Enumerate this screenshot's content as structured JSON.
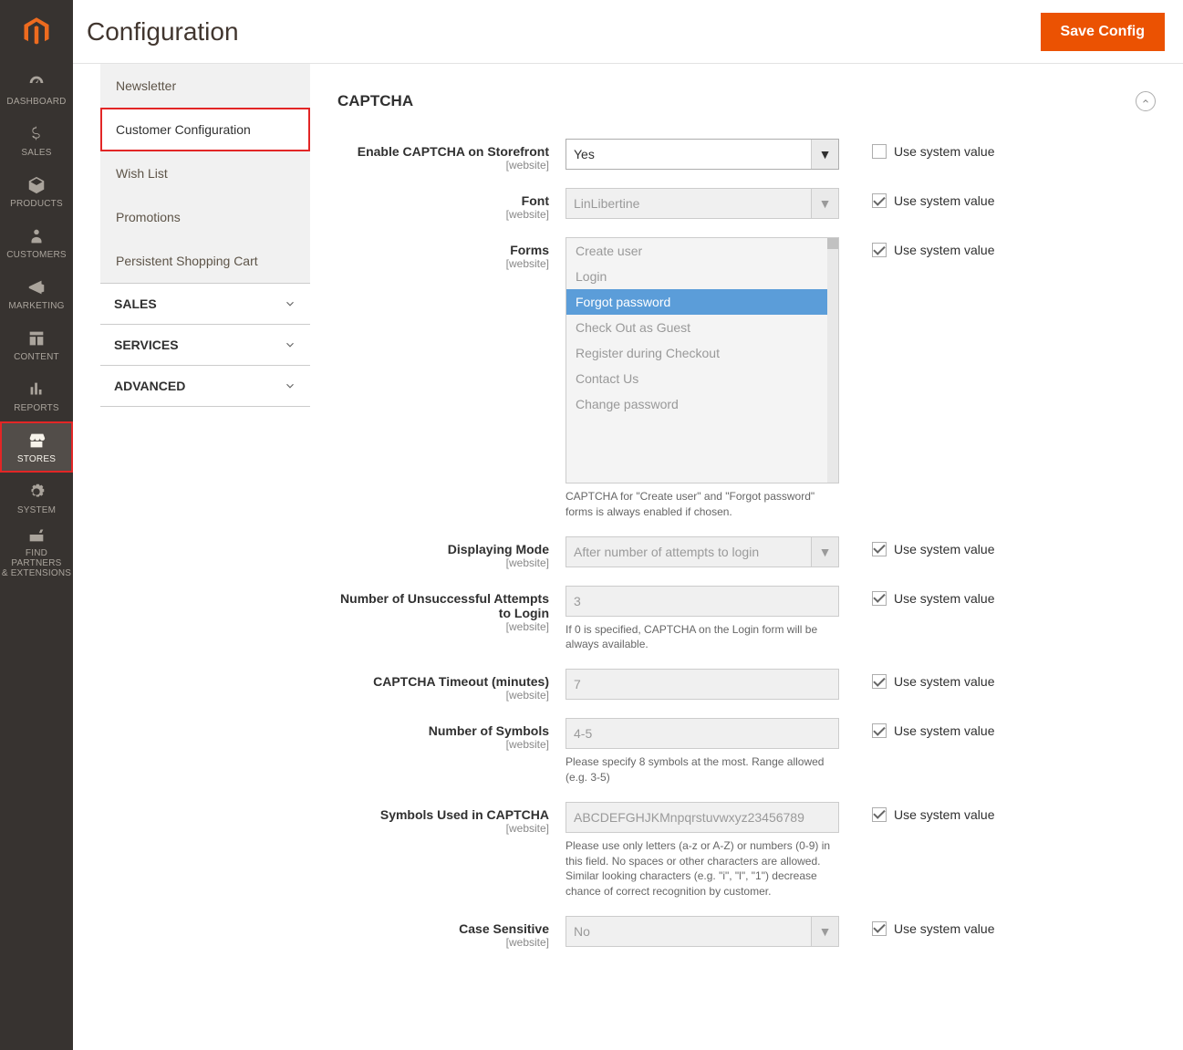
{
  "nav": {
    "items": [
      {
        "label": "DASHBOARD"
      },
      {
        "label": "SALES"
      },
      {
        "label": "PRODUCTS"
      },
      {
        "label": "CUSTOMERS"
      },
      {
        "label": "MARKETING"
      },
      {
        "label": "CONTENT"
      },
      {
        "label": "REPORTS"
      },
      {
        "label": "STORES"
      },
      {
        "label": "SYSTEM"
      },
      {
        "label": "FIND PARTNERS\n& EXTENSIONS"
      }
    ]
  },
  "header": {
    "title": "Configuration",
    "save_label": "Save Config"
  },
  "sidebar": {
    "items": [
      {
        "label": "Newsletter"
      },
      {
        "label": "Customer Configuration",
        "active": true
      },
      {
        "label": "Wish List"
      },
      {
        "label": "Promotions"
      },
      {
        "label": "Persistent Shopping Cart"
      }
    ],
    "sections": [
      {
        "label": "SALES"
      },
      {
        "label": "SERVICES"
      },
      {
        "label": "ADVANCED"
      }
    ]
  },
  "section": {
    "title": "CAPTCHA",
    "scope_label": "[website]",
    "system_value_label": "Use system value",
    "fields": {
      "enable": {
        "label": "Enable CAPTCHA on Storefront",
        "value": "Yes",
        "use_system": false,
        "disabled": false
      },
      "font": {
        "label": "Font",
        "value": "LinLibertine",
        "use_system": true,
        "disabled": true
      },
      "forms": {
        "label": "Forms",
        "use_system": true,
        "options": [
          "Create user",
          "Login",
          "Forgot password",
          "Check Out as Guest",
          "Register during Checkout",
          "Contact Us",
          "Change password"
        ],
        "selected": [
          "Forgot password"
        ],
        "help": "CAPTCHA for \"Create user\" and \"Forgot password\" forms is always enabled if chosen."
      },
      "mode": {
        "label": "Displaying Mode",
        "value": "After number of attempts to login",
        "use_system": true,
        "disabled": true
      },
      "attempts": {
        "label": "Number of Unsuccessful Attempts to Login",
        "value": "3",
        "use_system": true,
        "disabled": true,
        "help": "If 0 is specified, CAPTCHA on the Login form will be always available."
      },
      "timeout": {
        "label": "CAPTCHA Timeout (minutes)",
        "value": "7",
        "use_system": true,
        "disabled": true
      },
      "symbols_count": {
        "label": "Number of Symbols",
        "value": "4-5",
        "use_system": true,
        "disabled": true,
        "help": "Please specify 8 symbols at the most. Range allowed (e.g. 3-5)"
      },
      "symbols_used": {
        "label": "Symbols Used in CAPTCHA",
        "value": "ABCDEFGHJKMnpqrstuvwxyz23456789",
        "use_system": true,
        "disabled": true,
        "help": "Please use only letters (a-z or A-Z) or numbers (0-9) in this field. No spaces or other characters are allowed.\nSimilar looking characters (e.g. \"i\", \"l\", \"1\") decrease chance of correct recognition by customer."
      },
      "case_sensitive": {
        "label": "Case Sensitive",
        "value": "No",
        "use_system": true,
        "disabled": true
      }
    }
  }
}
